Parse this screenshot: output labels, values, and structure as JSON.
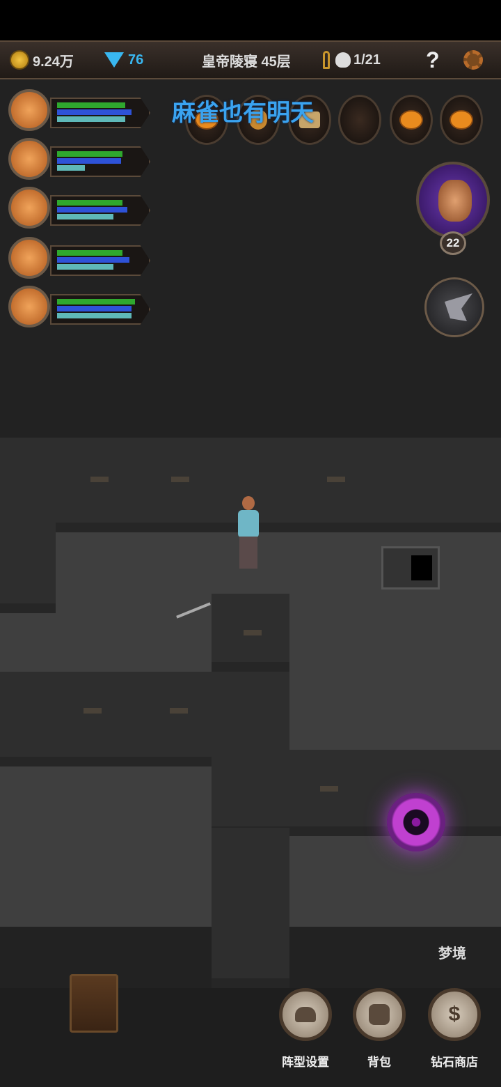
{
  "topbar": {
    "gold": "9.24万",
    "diamonds": "76",
    "location": "皇帝陵寝 45层",
    "kills": "1/21",
    "help": "?"
  },
  "party": [
    {
      "portrait_icon": "hero-elf-portrait",
      "hp": 0.85,
      "mp": 0.93,
      "xp": 0.85
    },
    {
      "portrait_icon": "hero-priest-portrait",
      "hp": 0.82,
      "mp": 0.8,
      "xp": 0.35
    },
    {
      "portrait_icon": "hero-redhood-portrait",
      "hp": 0.82,
      "mp": 0.88,
      "xp": 0.7
    },
    {
      "portrait_icon": "hero-masked-portrait",
      "hp": 0.82,
      "mp": 0.9,
      "xp": 0.7
    },
    {
      "portrait_icon": "hero-archer-portrait",
      "hp": 0.97,
      "mp": 0.93,
      "xp": 0.93
    }
  ],
  "loot_slots": [
    "pumpkin-icon",
    "pouch-icon",
    "scroll-icon",
    "empty-slot",
    "pumpkin-icon",
    "pumpkin-icon"
  ],
  "banner_text": "麻雀也有明天",
  "boss": {
    "icon": "angel-boss-icon",
    "level": "22"
  },
  "dungeon": {
    "dream_label": "梦境"
  },
  "bottom_buttons": [
    {
      "icon": "formation-icon",
      "label": "阵型设置"
    },
    {
      "icon": "backpack-icon",
      "label": "背包"
    },
    {
      "icon": "diamond-shop-icon",
      "glyph": "$",
      "label": "钻石商店"
    }
  ],
  "colors": {
    "hp": "#2fa82e",
    "mp": "#2e52d8",
    "xp": "#5fb8b8",
    "banner": "#3aa3f0",
    "portal": "#c040d0"
  }
}
